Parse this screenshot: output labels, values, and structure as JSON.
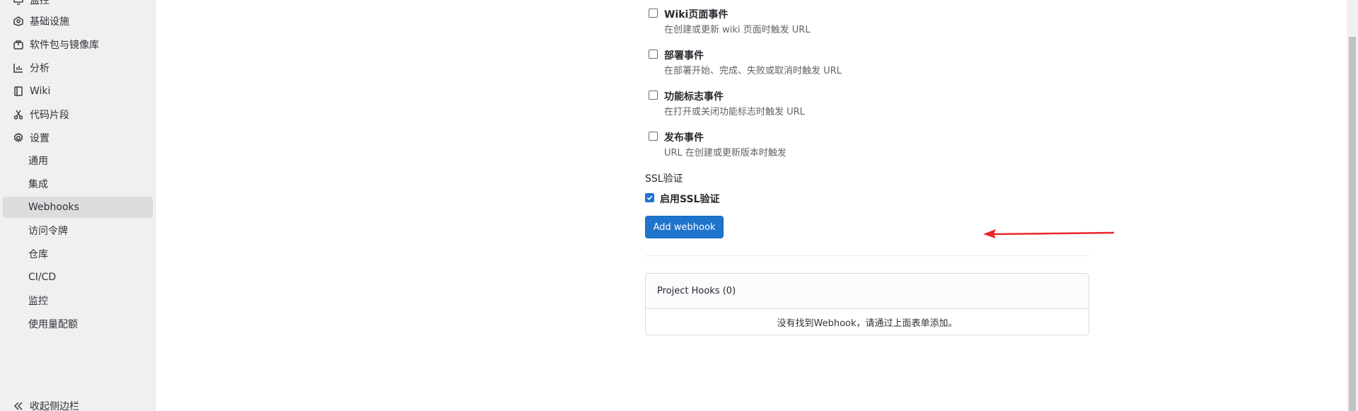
{
  "sidebar": {
    "items": [
      {
        "label": "监控",
        "icon": "monitor-icon"
      },
      {
        "label": "基础设施",
        "icon": "infrastructure-icon"
      },
      {
        "label": "软件包与镜像库",
        "icon": "package-icon"
      },
      {
        "label": "分析",
        "icon": "chart-icon"
      },
      {
        "label": "Wiki",
        "icon": "book-icon"
      },
      {
        "label": "代码片段",
        "icon": "snippet-icon"
      },
      {
        "label": "设置",
        "icon": "gear-icon"
      }
    ],
    "settings_sub": [
      "通用",
      "集成",
      "Webhooks",
      "访问令牌",
      "仓库",
      "CI/CD",
      "监控",
      "使用量配额"
    ],
    "active_sub": "Webhooks",
    "collapse_label": "收起侧边栏"
  },
  "events": [
    {
      "title": "Wiki页面事件",
      "desc": "在创建或更新 wiki 页面时触发 URL",
      "checked": false
    },
    {
      "title": "部署事件",
      "desc": "在部署开始、完成、失败或取消时触发 URL",
      "checked": false
    },
    {
      "title": "功能标志事件",
      "desc": "在打开或关闭功能标志时触发 URL",
      "checked": false
    },
    {
      "title": "发布事件",
      "desc": "URL 在创建或更新版本时触发",
      "checked": false
    }
  ],
  "ssl": {
    "heading": "SSL验证",
    "label": "启用SSL验证",
    "checked": true
  },
  "add_button": "Add webhook",
  "hooks": {
    "title": "Project Hooks (0)",
    "empty": "没有找到Webhook，请通过上面表单添加。"
  },
  "colors": {
    "primary": "#1f75cb",
    "annotation_arrow": "#e8262b"
  }
}
